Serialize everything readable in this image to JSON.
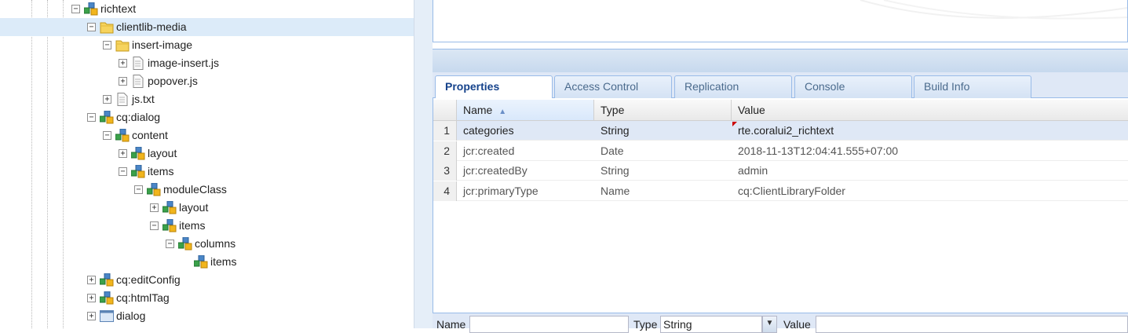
{
  "tree": {
    "nodes": [
      {
        "label": "richtext",
        "toggle": "−",
        "icon": "component-icon"
      },
      {
        "label": "clientlib-media",
        "toggle": "−",
        "icon": "folder-icon"
      },
      {
        "label": "insert-image",
        "toggle": "−",
        "icon": "folder-icon"
      },
      {
        "label": "image-insert.js",
        "toggle": "+",
        "icon": "file-icon"
      },
      {
        "label": "popover.js",
        "toggle": "+",
        "icon": "file-icon"
      },
      {
        "label": "js.txt",
        "toggle": "+",
        "icon": "file-icon"
      },
      {
        "label": "cq:dialog",
        "toggle": "−",
        "icon": "component-icon"
      },
      {
        "label": "content",
        "toggle": "−",
        "icon": "component-icon"
      },
      {
        "label": "layout",
        "toggle": "+",
        "icon": "component-icon"
      },
      {
        "label": "items",
        "toggle": "−",
        "icon": "component-icon"
      },
      {
        "label": "moduleClass",
        "toggle": "−",
        "icon": "component-icon"
      },
      {
        "label": "layout",
        "toggle": "+",
        "icon": "component-icon"
      },
      {
        "label": "items",
        "toggle": "−",
        "icon": "component-icon"
      },
      {
        "label": "columns",
        "toggle": "−",
        "icon": "component-icon"
      },
      {
        "label": "items",
        "toggle": "",
        "icon": "component-icon"
      },
      {
        "label": "cq:editConfig",
        "toggle": "+",
        "icon": "component-icon"
      },
      {
        "label": "cq:htmlTag",
        "toggle": "+",
        "icon": "component-icon"
      },
      {
        "label": "dialog",
        "toggle": "+",
        "icon": "dialog-icon"
      }
    ],
    "selected_index": 1
  },
  "tabs": [
    {
      "label": "Properties",
      "active": true
    },
    {
      "label": "Access Control",
      "active": false
    },
    {
      "label": "Replication",
      "active": false
    },
    {
      "label": "Console",
      "active": false
    },
    {
      "label": "Build Info",
      "active": false
    }
  ],
  "grid": {
    "columns": {
      "name": "Name",
      "type": "Type",
      "value": "Value"
    },
    "sort_indicator": "▲",
    "rows": [
      {
        "num": "1",
        "name": "categories",
        "type": "String",
        "value": "rte.coralui2_richtext"
      },
      {
        "num": "2",
        "name": "jcr:created",
        "type": "Date",
        "value": "2018-11-13T12:04:41.555+07:00"
      },
      {
        "num": "3",
        "name": "jcr:createdBy",
        "type": "String",
        "value": "admin"
      },
      {
        "num": "4",
        "name": "jcr:primaryType",
        "type": "Name",
        "value": "cq:ClientLibraryFolder"
      }
    ],
    "selected_row": 0
  },
  "form": {
    "name_label": "Name",
    "name_value": "",
    "type_label": "Type",
    "type_value": "String",
    "value_label": "Value",
    "value_value": ""
  },
  "colors": {
    "accent": "#15428b",
    "panel_border": "#99bbe8",
    "selection": "#dcebf9"
  }
}
